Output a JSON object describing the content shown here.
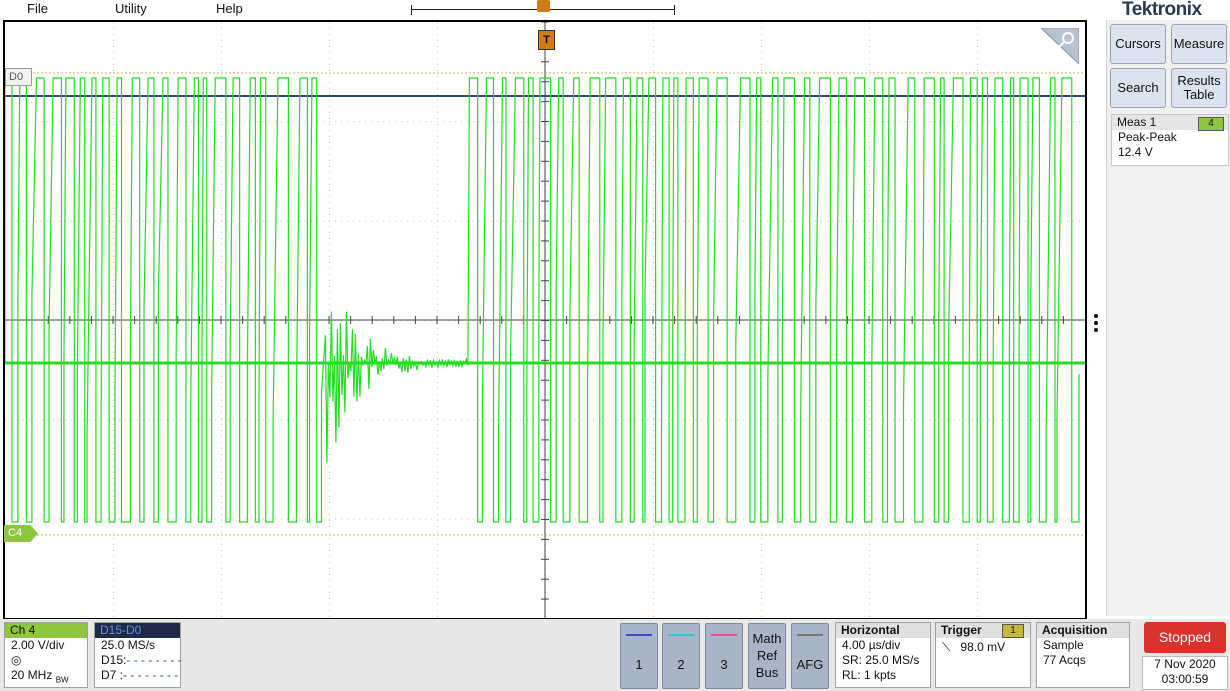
{
  "menu": [
    "File",
    "Utility",
    "Help"
  ],
  "brand": "Tektronix",
  "trigger_flag": "T",
  "right_panel": {
    "buttons": [
      {
        "label": "Cursors"
      },
      {
        "label": "Measure"
      },
      {
        "label": "Search"
      },
      {
        "label": "Results Table"
      }
    ],
    "meas": {
      "title": "Meas 1",
      "channel": "4",
      "type": "Peak-Peak",
      "value": "12.4 V"
    }
  },
  "graticule": {
    "d0_label": "D0",
    "c4_label": "C4"
  },
  "bottom": {
    "ch4": {
      "title": "Ch 4",
      "scale": "2.00 V/div",
      "bw": "20 MHz",
      "bw_suffix": "BW"
    },
    "digital": {
      "title": "D15-D0",
      "rate": "25.0 MS/s",
      "d15": "D15:",
      "d7": "D7 :"
    },
    "channels": [
      {
        "label": "1",
        "color": "#3a4bd0"
      },
      {
        "label": "2",
        "color": "#33c4d8"
      },
      {
        "label": "3",
        "color": "#e0559a"
      }
    ],
    "math_ref_bus": [
      "Math",
      "Ref",
      "Bus"
    ],
    "afg": "AFG",
    "horizontal": {
      "title": "Horizontal",
      "scale": "4.00 µs/div",
      "sr": "SR: 25.0 MS/s",
      "rl": "RL: 1 kpts"
    },
    "trigger": {
      "title": "Trigger",
      "source": "1",
      "level": "98.0 mV"
    },
    "acquisition": {
      "title": "Acquisition",
      "mode": "Sample",
      "count": "77 Acqs"
    },
    "run_state": "Stopped",
    "date": "7 Nov 2020",
    "time": "03:00:59"
  },
  "colors": {
    "trace": "#22dd22",
    "d0_line": "#2a4a7a",
    "stopped": "#d9322c",
    "ch4": "#8dc63f"
  }
}
